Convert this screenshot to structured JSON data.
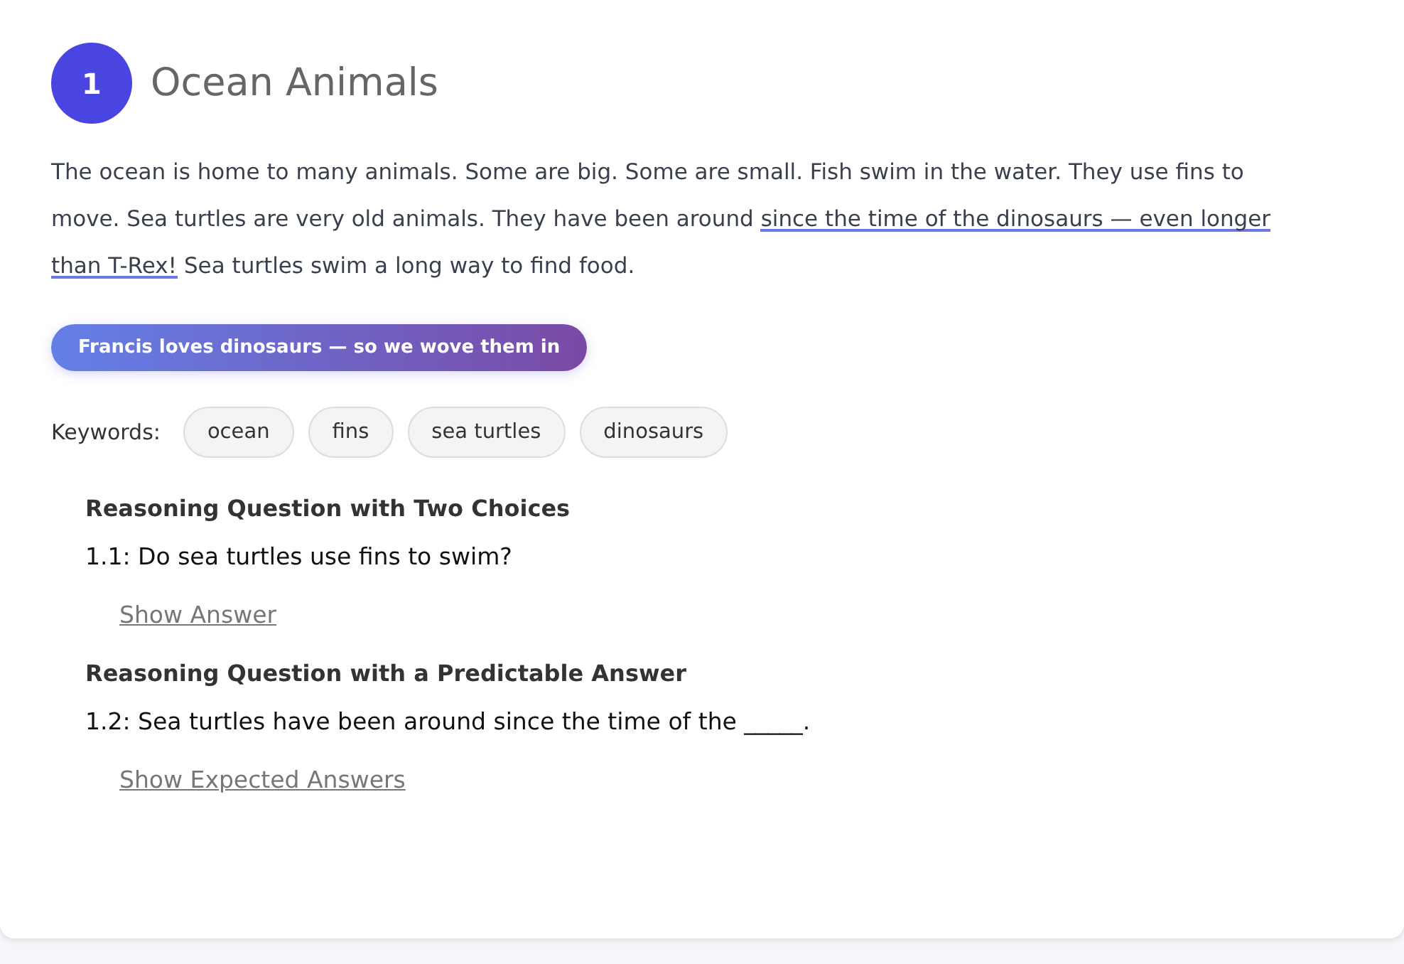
{
  "section": {
    "number": "1",
    "title": "Ocean Animals",
    "paragraph": [
      {
        "text": "The ocean is home to many animals. Some are big. Some are small. Fish swim in the water. They use fins to move. Sea turtles are very old animals. They have been around ",
        "highlighted": false
      },
      {
        "text": "since the time of the dinosaurs — even longer than T-Rex!",
        "highlighted": true
      },
      {
        "text": " Sea turtles swim a long way to find food.",
        "highlighted": false
      }
    ],
    "personal_badge": "Francis loves dinosaurs — so we wove them in",
    "keywords_label": "Keywords:",
    "keywords": [
      "ocean",
      "fins",
      "sea turtles",
      "dinosaurs"
    ],
    "questions": [
      {
        "heading": "Reasoning Question with Two Choices",
        "question": "1.1: Do sea turtles use fins to swim?",
        "link": "Show Answer"
      },
      {
        "heading": "Reasoning Question with a Predictable Answer",
        "question": "1.2: Sea turtles have been around since the time of the _____.",
        "link": "Show Expected Answers"
      }
    ]
  }
}
